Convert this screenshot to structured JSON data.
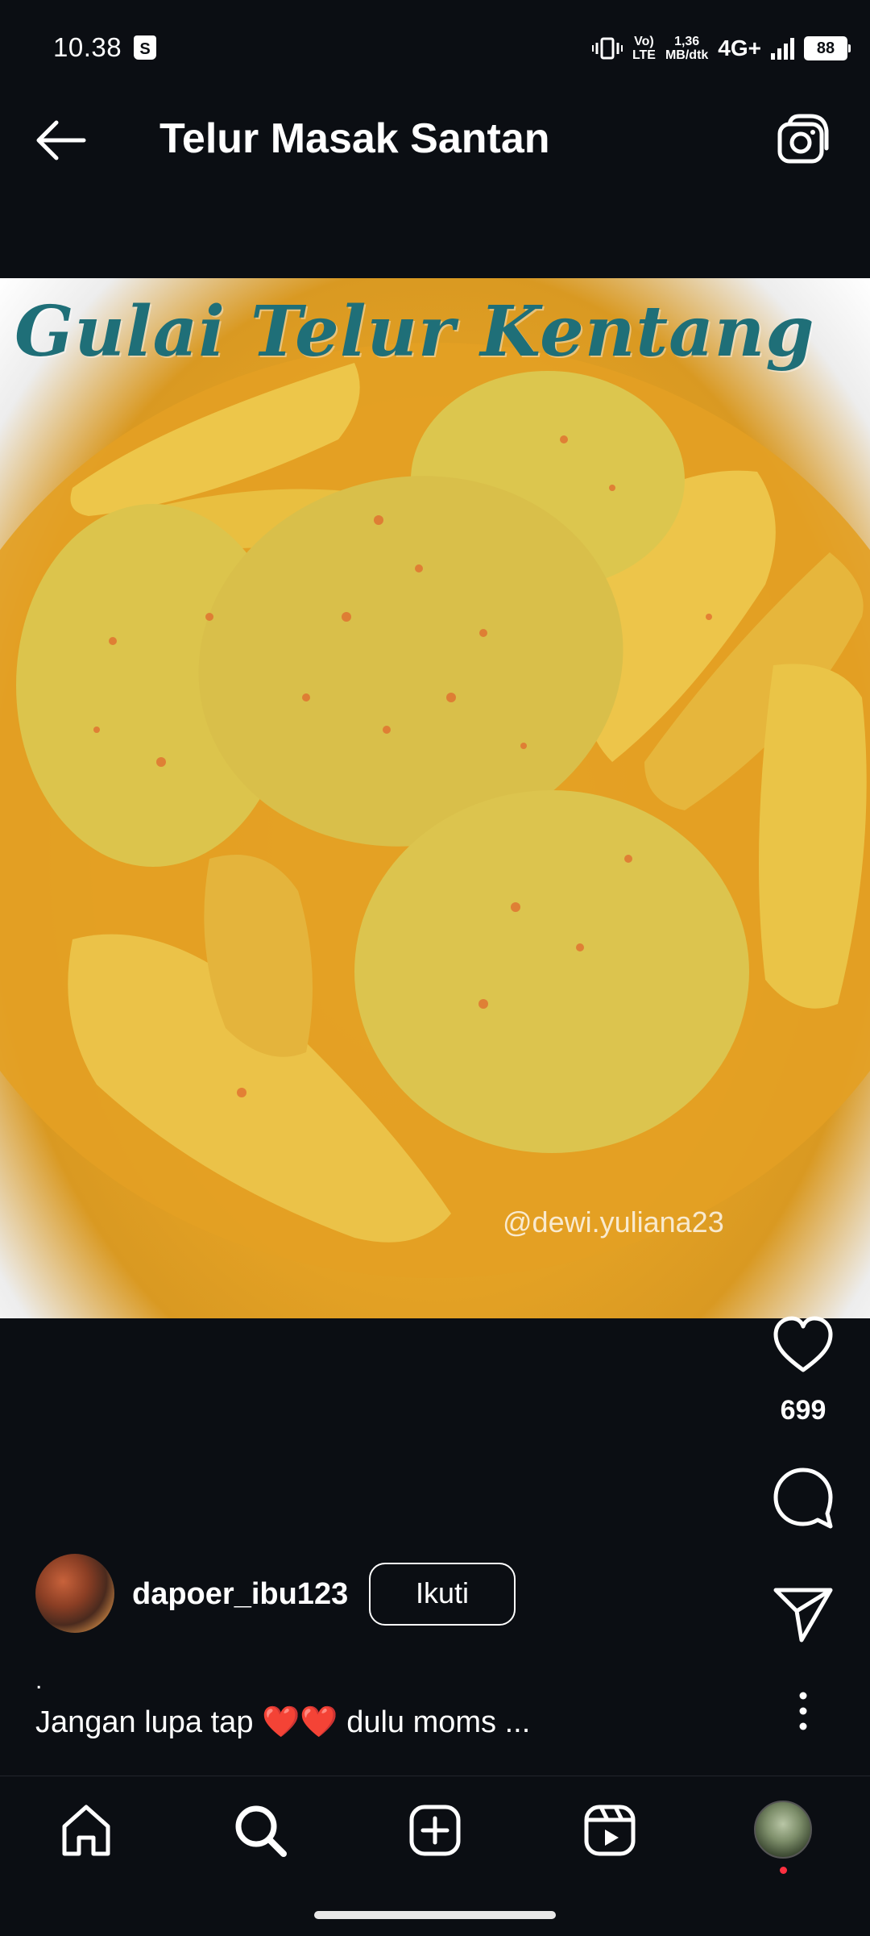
{
  "status_bar": {
    "time": "10.38",
    "shop_icon": "S",
    "volte": "Vo)\nLTE",
    "speed": "1,36\nMB/dtk",
    "network": "4G+",
    "battery": "88"
  },
  "header": {
    "title": "Telur Masak Santan"
  },
  "post": {
    "image_caption": "Gulai Telur Kentang",
    "watermark": "@dewi.yuliana23",
    "like_count": "699",
    "username": "dapoer_ibu123",
    "follow_label": "Ikuti",
    "caption_dot": ".",
    "caption": "Jangan lupa tap ❤️❤️ dulu moms ..."
  },
  "icons": {
    "back": "arrow-left-icon",
    "camera": "camera-icon",
    "like": "heart-icon",
    "comment": "comment-icon",
    "share": "send-icon",
    "more": "more-vertical-icon",
    "home": "home-icon",
    "search": "search-icon",
    "create": "plus-square-icon",
    "reels": "reels-icon"
  },
  "colors": {
    "background": "#0b0e13",
    "caption_teal": "#1f6f78",
    "notification_dot": "#ff3040"
  }
}
